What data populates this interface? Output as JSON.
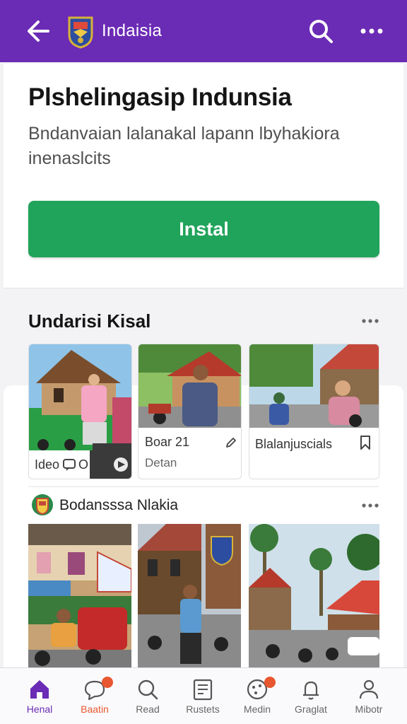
{
  "header": {
    "title": "Indaisia",
    "back_icon": "arrow-left-icon",
    "logo_icon": "crest-logo-icon",
    "search_icon": "search-icon",
    "more_icon": "more-horizontal-icon",
    "background": "#6a2bb5"
  },
  "app_card": {
    "title": "Plshelingasip Indunsia",
    "description": "Bndanvaian  lalanakal lapann lbyhakiora inenaslcits",
    "install_label": "Instal",
    "install_color": "#20a35a"
  },
  "section_1": {
    "title": "Undarisi Kisal",
    "more_icon": "more-horizontal-icon",
    "tiles": [
      {
        "label": "Ideo",
        "badge": "O",
        "icons": [
          "chat-icon",
          "play-icon"
        ]
      },
      {
        "label": "Boar 21",
        "sub": "Detan",
        "icon": "pencil-icon"
      },
      {
        "label": "Blalanjuscials",
        "icon": "bookmark-icon"
      }
    ]
  },
  "section_2": {
    "title": "Bodansssa Nlakia",
    "logo_icon": "crest-logo-icon",
    "more_icon": "more-horizontal-icon"
  },
  "bottom_nav": {
    "active_color": "#6a2bb5",
    "items": [
      {
        "label": "Henal",
        "icon": "home-icon",
        "active": true,
        "badge": false
      },
      {
        "label": "Baatin",
        "icon": "chat-bubble-icon",
        "active": false,
        "badge": true,
        "label_color": "#e8572f"
      },
      {
        "label": "Read",
        "icon": "search-icon",
        "active": false,
        "badge": false
      },
      {
        "label": "Rustets",
        "icon": "document-icon",
        "active": false,
        "badge": false
      },
      {
        "label": "Medin",
        "icon": "media-icon",
        "active": false,
        "badge": true
      },
      {
        "label": "Graglat",
        "icon": "bell-icon",
        "active": false,
        "badge": false
      },
      {
        "label": "Mibotr",
        "icon": "user-icon",
        "active": false,
        "badge": false
      }
    ]
  }
}
